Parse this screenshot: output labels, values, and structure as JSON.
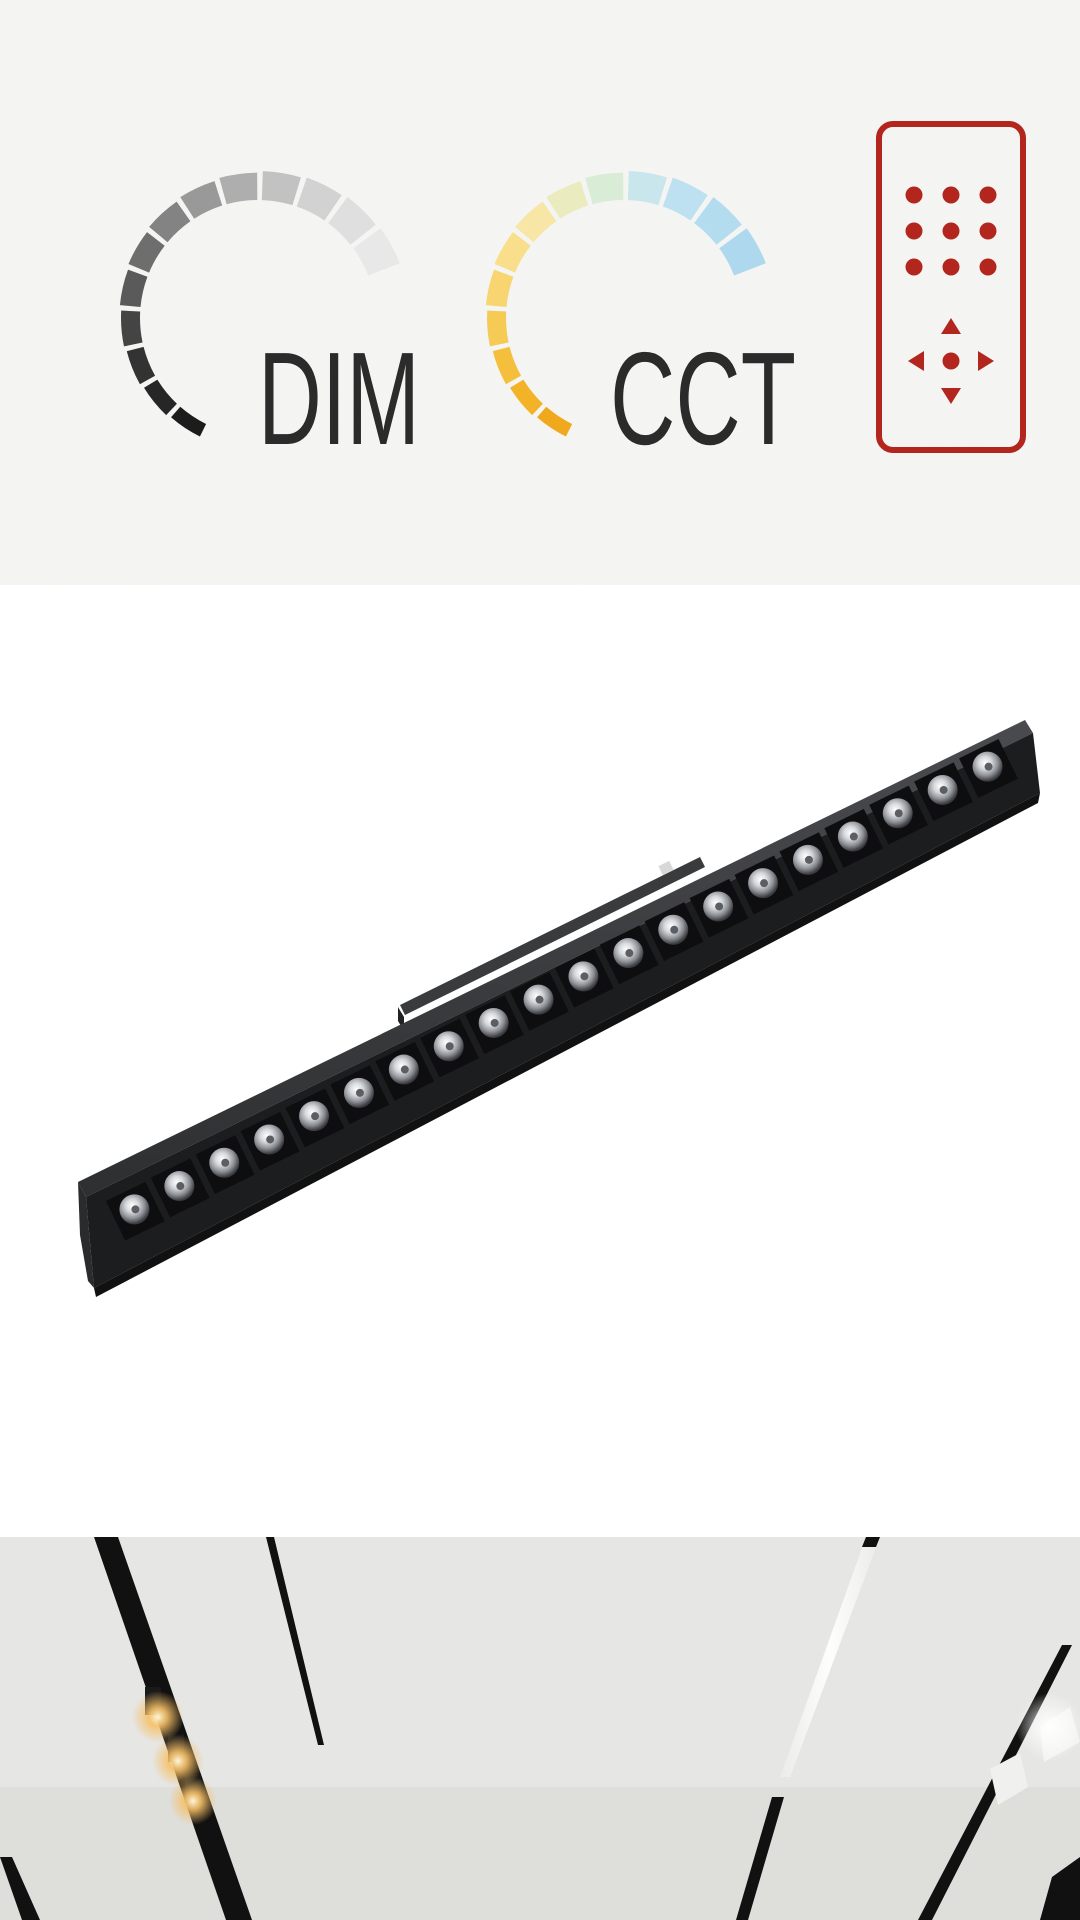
{
  "features": {
    "dim": {
      "label": "DIM",
      "icon": "dim-dial-icon",
      "segment_colors": [
        "#1c1c1c",
        "#262626",
        "#333333",
        "#444444",
        "#5a5a5a",
        "#6e6e6e",
        "#838383",
        "#999999",
        "#aeaeae",
        "#c2c2c2",
        "#d2d2d2",
        "#dfdfdf",
        "#e8e8e8"
      ]
    },
    "cct": {
      "label": "CCT",
      "icon": "cct-dial-icon",
      "segment_colors": [
        "#f0a81c",
        "#f2b328",
        "#f4bf3c",
        "#f6cb55",
        "#f8d570",
        "#f9df8c",
        "#f7e6a6",
        "#eaecc0",
        "#d8ecd6",
        "#c8e6ec",
        "#bde1f0",
        "#b4dcef",
        "#aed8ee"
      ]
    },
    "remote": {
      "icon": "remote-control-icon",
      "color": "#b3261e"
    }
  },
  "product": {
    "name": "linear-track-light",
    "led_count": 20,
    "housing_color": "#2e2f31"
  },
  "scene": {
    "description_icon": "ceiling-track-lights-photo"
  }
}
